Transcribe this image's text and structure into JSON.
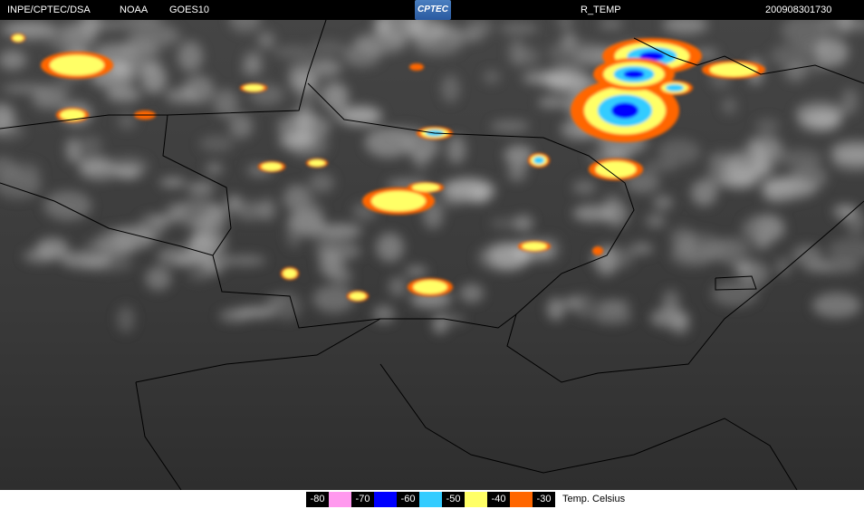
{
  "header": {
    "source": "INPE/CPTEC/DSA",
    "agency": "NOAA",
    "satellite": "GOES10",
    "logo_text": "CPTEC",
    "product": "R_TEMP",
    "timestamp": "200908301730"
  },
  "legend": {
    "title": "Temp. Celsius",
    "entries": [
      {
        "label": "-80",
        "color": "#ff99ee"
      },
      {
        "label": "-70",
        "color": "#0000ff"
      },
      {
        "label": "-60",
        "color": "#33ccff"
      },
      {
        "label": "-50",
        "color": "#ffff66"
      },
      {
        "label": "-40",
        "color": "#ff6600"
      },
      {
        "label": "-30",
        "color": null
      }
    ]
  }
}
